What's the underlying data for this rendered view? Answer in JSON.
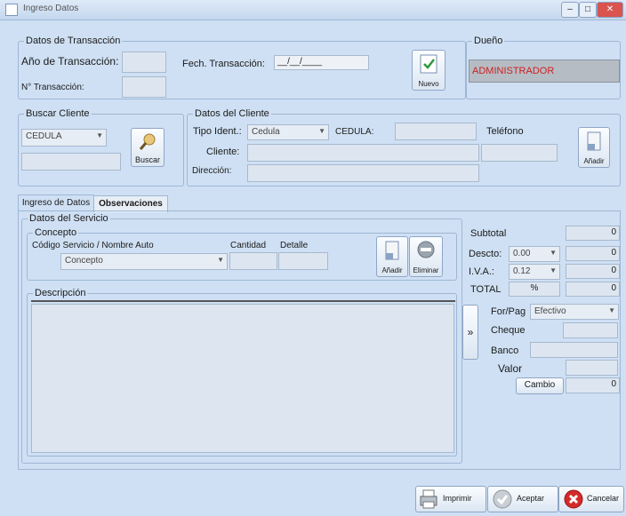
{
  "window": {
    "title": "Ingreso Datos"
  },
  "transaccion": {
    "group_title": "Datos de Transacción",
    "anio_label": "Año de Transacción:",
    "numero_label": "N° Transacción:",
    "fecha_label": "Fech. Transacción:",
    "fecha_value": "__/__/____",
    "nuevo_label": "Nuevo"
  },
  "dueno": {
    "group_title": "Dueño",
    "value": "ADMINISTRADOR"
  },
  "buscar_cliente": {
    "group_title": "Buscar Cliente",
    "combo_value": "CEDULA",
    "button_label": "Buscar"
  },
  "datos_cliente": {
    "group_title": "Datos del Cliente",
    "tipo_label": "Tipo Ident.:",
    "tipo_value": "Cedula",
    "cedula_label": "CEDULA:",
    "telefono_label": "Teléfono",
    "cliente_label": "Cliente:",
    "direccion_label": "Dirección:",
    "anadir_label": "Añadir"
  },
  "tabs": [
    {
      "label": "Ingreso de Datos"
    },
    {
      "label": "Observaciones"
    }
  ],
  "servicio": {
    "group_title": "Datos del Servicio",
    "concepto_title": "Concepto",
    "codigo_label": "Código Servicio / Nombre Auto",
    "codigo_value": "Concepto",
    "cantidad_label": "Cantidad",
    "detalle_label": "Detalle",
    "anadir_label": "Añadir",
    "eliminar_label": "Eliminar",
    "descripcion_label": "Descripción"
  },
  "totales": {
    "subtotal_label": "Subtotal",
    "subtotal_value": "0",
    "descto_label": "Descto:",
    "descto_pct": "0.00",
    "descto_value": "0",
    "iva_label": "I.V.A.:",
    "iva_pct": "0.12",
    "iva_value": "0",
    "total_label": "TOTAL",
    "total_pct": "%",
    "total_value": "0"
  },
  "pago": {
    "arrow": "»",
    "forma_label": "For/Pag",
    "forma_value": "Efectivo",
    "cheque_label": "Cheque",
    "banco_label": "Banco",
    "valor_label": "Valor",
    "cambio_label": "Cambio",
    "cambio_value": "0"
  },
  "footer": {
    "imprimir_label": "Imprimir",
    "aceptar_label": "Aceptar",
    "cancelar_label": "Cancelar"
  }
}
